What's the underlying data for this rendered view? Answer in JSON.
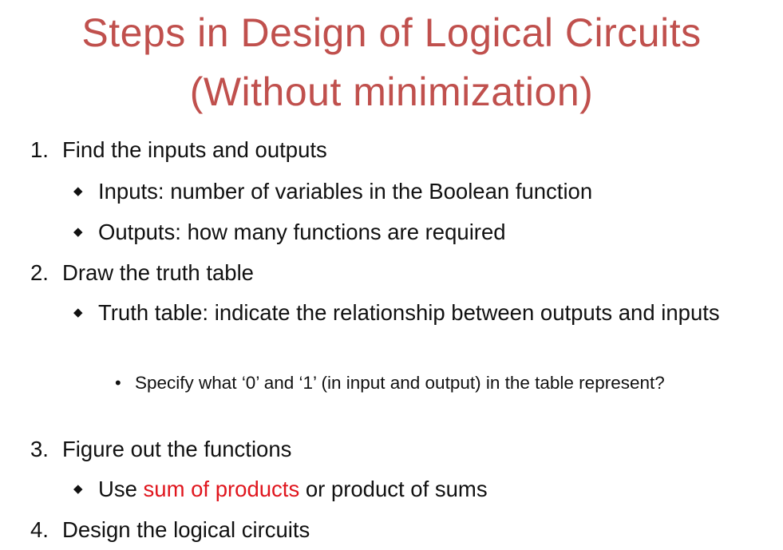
{
  "title": {
    "line1": "Steps in Design of Logical Circuits",
    "line2": "(Without minimization)"
  },
  "steps": [
    {
      "number": "1.",
      "text": "Find the inputs and outputs",
      "subitems": [
        "Inputs: number of variables in the Boolean function",
        "Outputs: how many functions are required"
      ]
    },
    {
      "number": "2.",
      "text": "Draw the truth table",
      "subitems": [
        "Truth table: indicate the relationship between outputs and inputs"
      ],
      "subsubitems": [
        "Specify what ‘0’ and ‘1’ (in input and output) in the table represent?"
      ]
    },
    {
      "number": "3.",
      "text": "Figure out the functions",
      "subitem_parts": {
        "before": "Use ",
        "highlight": "sum of products",
        "after": " or product of sums"
      }
    },
    {
      "number": "4.",
      "text": "Design the logical circuits"
    }
  ],
  "icons": {
    "level2_bullet": "diamond-bullet-icon",
    "level3_bullet": "dot-bullet-icon"
  },
  "colors": {
    "title": "#c0504d",
    "highlight": "#e0161e",
    "text": "#111111"
  }
}
